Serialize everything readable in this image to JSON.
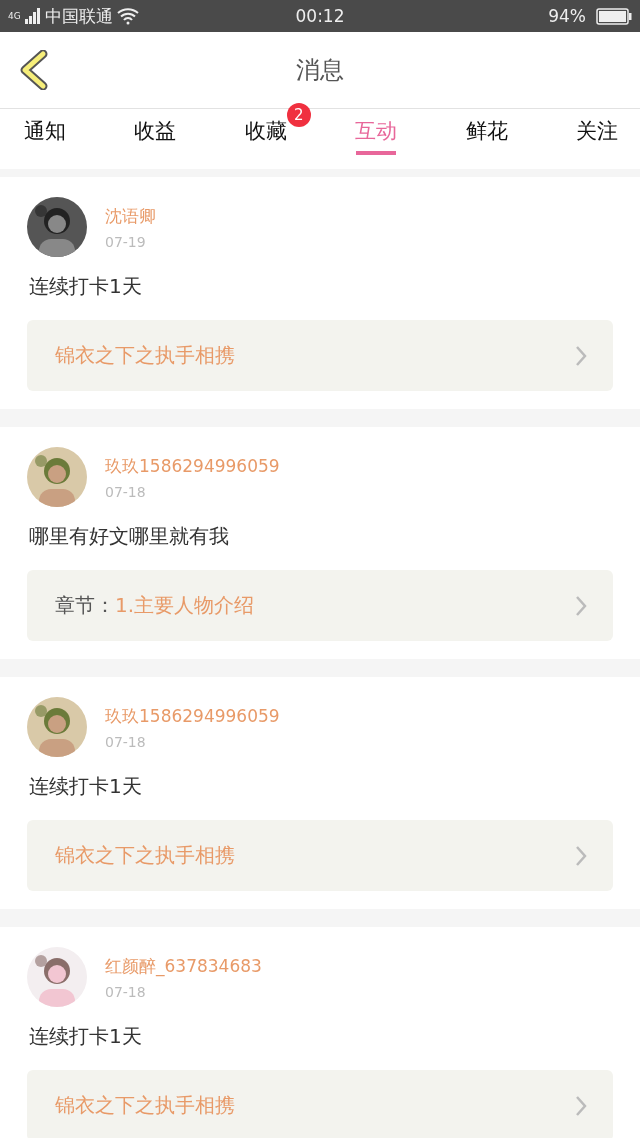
{
  "status_bar": {
    "network": "4G",
    "carrier": "中国联通",
    "time": "00:12",
    "battery": "94%"
  },
  "header": {
    "title": "消息"
  },
  "tabs": [
    {
      "label": "通知",
      "selected": false
    },
    {
      "label": "收益",
      "selected": false
    },
    {
      "label": "收藏",
      "selected": false,
      "badge": "2"
    },
    {
      "label": "互动",
      "selected": true
    },
    {
      "label": "鲜花",
      "selected": false
    },
    {
      "label": "关注",
      "selected": false
    }
  ],
  "messages": [
    {
      "name": "沈语卿",
      "date": "07-19",
      "text": "连续打卡1天",
      "link": {
        "kind": "book",
        "title": "锦衣之下之执手相携"
      }
    },
    {
      "name": "玖玖1586294996059",
      "date": "07-18",
      "text": "哪里有好文哪里就有我",
      "link": {
        "kind": "chapter",
        "label": "章节：",
        "title": "1.主要人物介绍"
      }
    },
    {
      "name": "玖玖1586294996059",
      "date": "07-18",
      "text": "连续打卡1天",
      "link": {
        "kind": "book",
        "title": "锦衣之下之执手相携"
      }
    },
    {
      "name": "红颜醉_637834683",
      "date": "07-18",
      "text": "连续打卡1天",
      "link": {
        "kind": "book",
        "title": "锦衣之下之执手相携"
      }
    }
  ]
}
